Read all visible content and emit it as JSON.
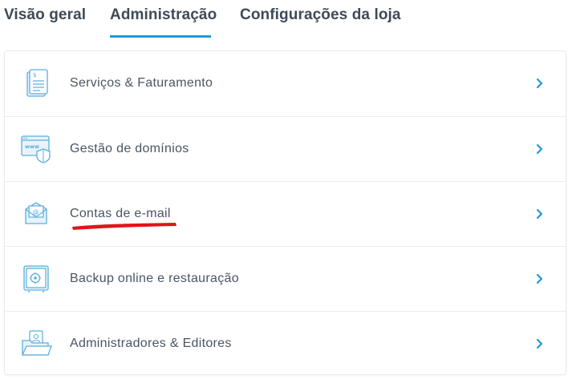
{
  "tabs": [
    {
      "label": "Visão geral",
      "active": false
    },
    {
      "label": "Administração",
      "active": true
    },
    {
      "label": "Configurações da loja",
      "active": false
    }
  ],
  "list": [
    {
      "label": "Serviços & Faturamento",
      "icon": "invoice-icon"
    },
    {
      "label": "Gestão de domínios",
      "icon": "domain-shield-icon"
    },
    {
      "label": "Contas de e-mail",
      "icon": "email-icon"
    },
    {
      "label": "Backup online e restauração",
      "icon": "safe-icon"
    },
    {
      "label": "Administradores & Editores",
      "icon": "admin-folder-icon"
    }
  ],
  "colors": {
    "accent": "#1e9ad6",
    "icon_stroke": "#5aaedf",
    "icon_fill": "#e8f3fb",
    "text": "#4a5563",
    "annotation": "#e0141b"
  }
}
